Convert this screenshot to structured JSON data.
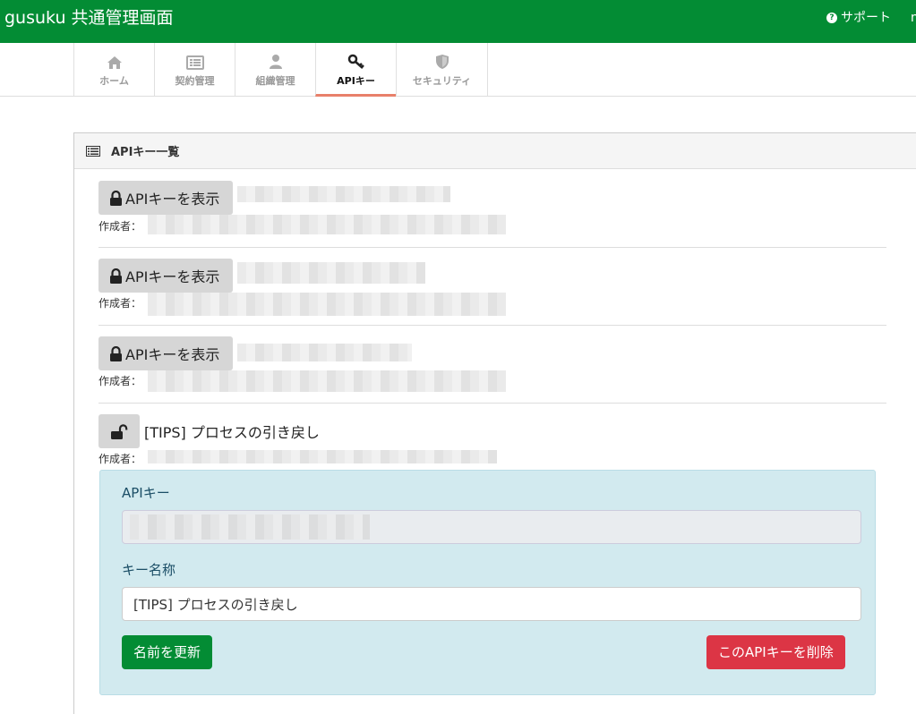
{
  "header": {
    "brand": "gusuku 共通管理画面",
    "support": "サポート",
    "user_cut": "n"
  },
  "tabs": [
    {
      "label": "ホーム",
      "icon": "home-icon"
    },
    {
      "label": "契約管理",
      "icon": "list-icon"
    },
    {
      "label": "組織管理",
      "icon": "user-icon"
    },
    {
      "label": "APIキー",
      "icon": "key-icon",
      "active": true
    },
    {
      "label": "セキュリティ",
      "icon": "shield-icon"
    }
  ],
  "panel": {
    "title": "APIキー一覧"
  },
  "keys": [
    {
      "button": "APIキーを表示",
      "creator_label": "作成者：",
      "name": "",
      "creator": ""
    },
    {
      "button": "APIキーを表示",
      "creator_label": "作成者：",
      "name": "",
      "creator": ""
    },
    {
      "button": "APIキーを表示",
      "creator_label": "作成者：",
      "name": "",
      "creator": ""
    },
    {
      "button": "",
      "creator_label": "作成者：",
      "name": "[TIPS] プロセスの引き戻し",
      "creator": ""
    }
  ],
  "detail": {
    "api_key_label": "APIキー",
    "api_key_value": "",
    "key_name_label": "キー名称",
    "key_name_value": "[TIPS] プロセスの引き戻し",
    "update_button": "名前を更新",
    "delete_button": "このAPIキーを削除"
  },
  "colors": {
    "brand": "#038c34",
    "danger": "#dc3545",
    "active_tab_underline": "#e8806a",
    "detail_bg": "#d2eaef"
  }
}
